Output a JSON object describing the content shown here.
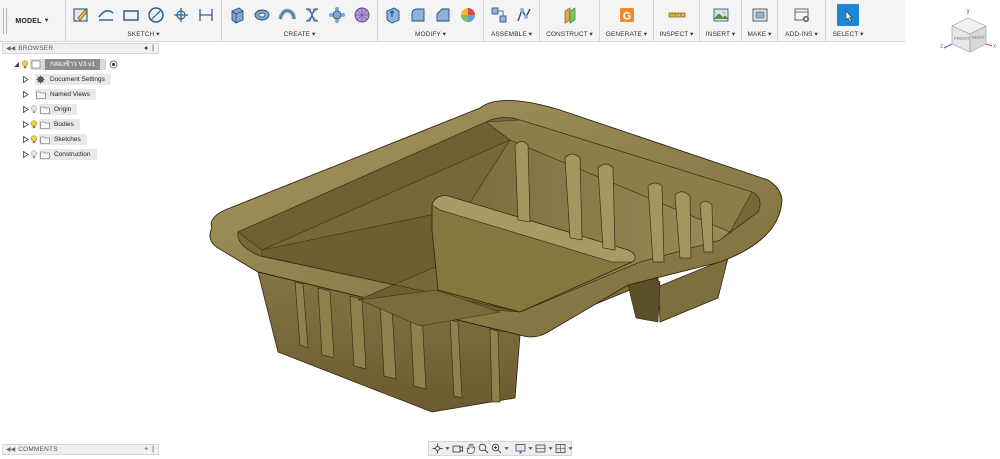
{
  "workspace": {
    "label": "MODEL"
  },
  "toolbar": {
    "groups": [
      {
        "label": "SKETCH ▾"
      },
      {
        "label": "CREATE ▾"
      },
      {
        "label": "MODIFY ▾"
      },
      {
        "label": "ASSEMBLE ▾"
      },
      {
        "label": "CONSTRUCT ▾"
      },
      {
        "label": "GENERATE ▾"
      },
      {
        "label": "INSPECT ▾"
      },
      {
        "label": "INSERT ▾"
      },
      {
        "label": "MAKE ▾"
      },
      {
        "label": "ADD-INS ▾"
      },
      {
        "label": "SELECT ▾"
      }
    ],
    "accent_color": "#1d89d4"
  },
  "browser": {
    "title": "BROWSER",
    "root_label": "กล่องข้าว V3 v1",
    "items": [
      {
        "label": "Document Settings",
        "icon": "gear-icon"
      },
      {
        "label": "Named Views",
        "icon": "folder-icon"
      },
      {
        "label": "Origin",
        "icon": "folder-icon"
      },
      {
        "label": "Bodies",
        "icon": "folder-icon"
      },
      {
        "label": "Sketches",
        "icon": "folder-icon"
      },
      {
        "label": "Construction",
        "icon": "folder-icon"
      }
    ]
  },
  "comments": {
    "title": "COMMENTS"
  },
  "viewcube": {
    "face_front": "FRONT",
    "face_right": "RIGHT",
    "axis_x": "X",
    "axis_y": "Y",
    "axis_z": "Z"
  },
  "model": {
    "color": "#8a7a45"
  }
}
